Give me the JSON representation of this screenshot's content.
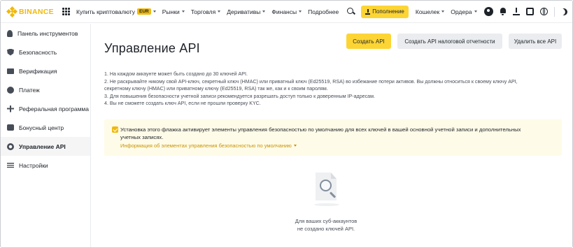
{
  "header": {
    "logo_text": "BINANCE",
    "nav": [
      {
        "label": "Купить криптовалюту",
        "badge": "EUR"
      },
      {
        "label": "Рынки"
      },
      {
        "label": "Торговля"
      },
      {
        "label": "Деривативы"
      },
      {
        "label": "Финансы"
      },
      {
        "label": "Подробнее"
      }
    ],
    "deposit_label": "Пополнение",
    "wallet_label": "Кошелек",
    "orders_label": "Ордера"
  },
  "sidebar": {
    "items": [
      {
        "label": "Панель инструментов",
        "icon": "person-icon"
      },
      {
        "label": "Безопасность",
        "icon": "shield-icon"
      },
      {
        "label": "Верификация",
        "icon": "id-card-icon"
      },
      {
        "label": "Платеж",
        "icon": "coin-icon"
      },
      {
        "label": "Реферальная программа",
        "icon": "add-person-icon"
      },
      {
        "label": "Бонусный центр",
        "icon": "gift-icon"
      },
      {
        "label": "Управление API",
        "icon": "api-icon",
        "active": true
      },
      {
        "label": "Настройки",
        "icon": "settings-icon"
      }
    ]
  },
  "main": {
    "title": "Управление API",
    "buttons": {
      "create": "Создать API",
      "tax": "Создать API налоговой отчетности",
      "delete_all": "Удалить все API"
    },
    "notes": [
      "1. На каждом аккаунте может быть создано до 30 ключей API.",
      "2. Не раскрывайте никому свой API-ключ, секретный ключ (HMAC) или приватный ключ (Ed25519, RSA) во избежание потери активов. Вы должны относиться к своему ключу API,",
      "секретному ключу (HMAC) или приватному ключу (Ed25519, RSA) так же, как и к своим паролям.",
      "3. Для повышения безопасности учетной записи рекомендуется разрешать доступ только к доверенным IP-адресам.",
      "4. Вы не сможете создать ключ API, если не прошли проверку KYC."
    ],
    "notice": {
      "checked": true,
      "text": "Установка этого флажка активирует элементы управления безопасностью по умолчанию для всех ключей в вашей основной учетной записи и дополнительных учетных записях.",
      "link": "Информация об элементах управления безопасностью по умолчанию"
    },
    "empty": {
      "line1": "Для ваших суб-аккаунтов",
      "line2": "не создано ключей API."
    }
  },
  "colors": {
    "brand": "#f0b90b",
    "button_yellow": "#fcd535",
    "notice_bg": "#fefbe8",
    "link": "#c99400"
  }
}
